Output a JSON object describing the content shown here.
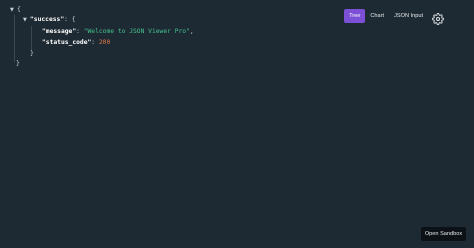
{
  "view_tabs": [
    {
      "label": "Tree",
      "active": true
    },
    {
      "label": "Chart",
      "active": false
    },
    {
      "label": "JSON Input",
      "active": false
    }
  ],
  "settings_icon": "gear-icon",
  "json": {
    "root_open": "{",
    "root_close": "}",
    "key_success": "\"success\"",
    "success_open": "{",
    "success_close": "}",
    "key_message": "\"message\"",
    "val_message": "\"Welcome to JSON Viewer Pro\"",
    "key_status": "\"status_code\"",
    "val_status": "200"
  },
  "sandbox_button_label": "Open Sandbox",
  "colors": {
    "background": "#1e2a33",
    "accent": "#7b4fd6",
    "string": "#44c18f",
    "number": "#e07a4a"
  }
}
